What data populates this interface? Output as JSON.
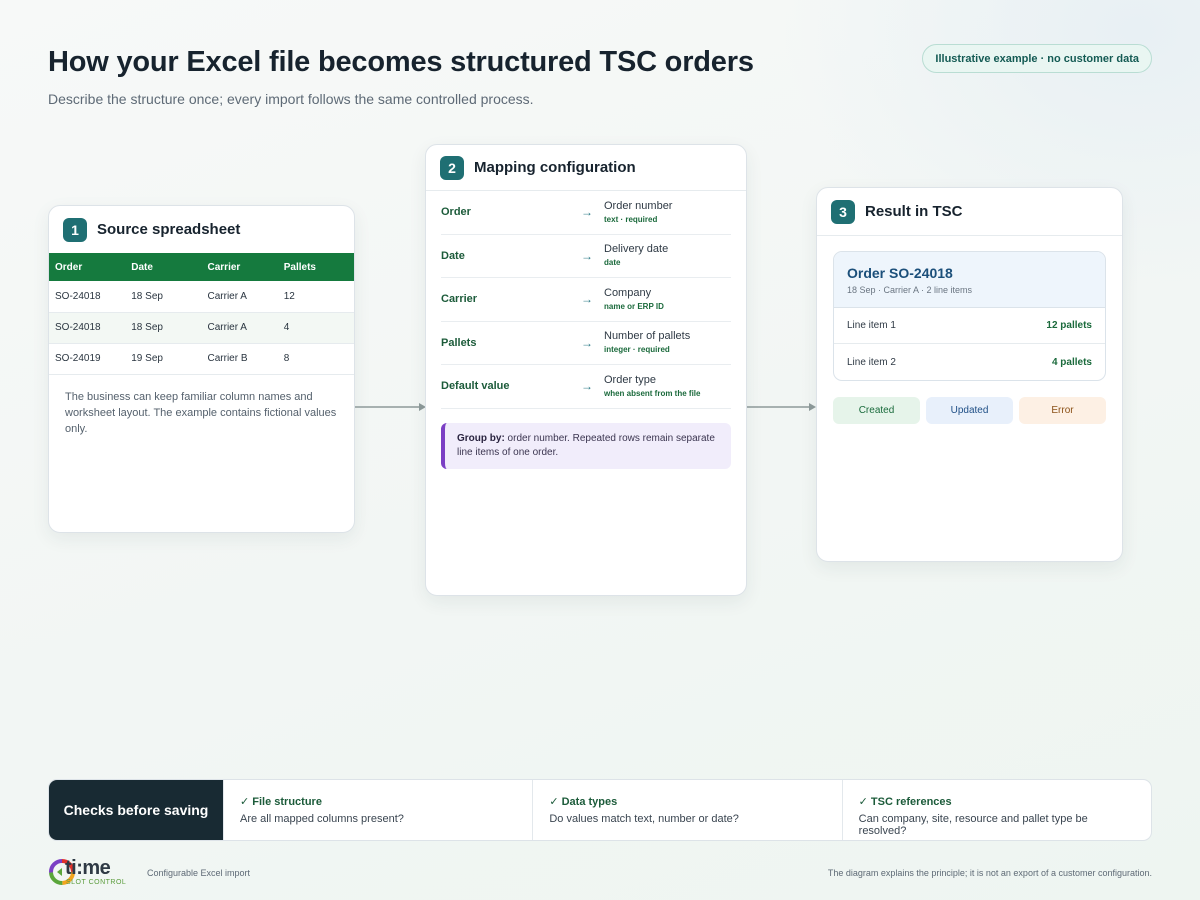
{
  "header": {
    "title": "How your Excel file becomes structured TSC orders",
    "subtitle": "Describe the structure once; every import follows the same controlled process.",
    "badge": "Illustrative example · no customer data"
  },
  "source": {
    "step": "1",
    "title": "Source spreadsheet",
    "columns": [
      "Order",
      "Date",
      "Carrier",
      "Pallets"
    ],
    "rows": [
      [
        "SO-24018",
        "18 Sep",
        "Carrier A",
        "12"
      ],
      [
        "SO-24018",
        "18 Sep",
        "Carrier A",
        "4"
      ],
      [
        "SO-24019",
        "19 Sep",
        "Carrier B",
        "8"
      ]
    ],
    "note": "The business can keep familiar column names and worksheet layout. The example contains fictional values only."
  },
  "mapping": {
    "step": "2",
    "title": "Mapping configuration",
    "arrow": "→",
    "rows": [
      {
        "source": "Order",
        "target": "Order number",
        "type": "text · required"
      },
      {
        "source": "Date",
        "target": "Delivery date",
        "type": "date"
      },
      {
        "source": "Carrier",
        "target": "Company",
        "type": "name or ERP ID"
      },
      {
        "source": "Pallets",
        "target": "Number of pallets",
        "type": "integer · required"
      },
      {
        "source": "Default value",
        "target": "Order type",
        "type": "when absent from the file"
      }
    ],
    "group_label": "Group by:",
    "group_text": " order number. Repeated rows remain separate line items of one order."
  },
  "result": {
    "step": "3",
    "title": "Result in TSC",
    "order_title": "Order SO-24018",
    "order_meta": "18 Sep · Carrier A · 2 line items",
    "lines": [
      {
        "label": "Line item 1",
        "qty": "12 pallets"
      },
      {
        "label": "Line item 2",
        "qty": "4 pallets"
      }
    ],
    "statuses": [
      "Created",
      "Updated",
      "Error"
    ]
  },
  "checks": {
    "title": "Checks before saving",
    "items": [
      {
        "title": "✓ File structure",
        "desc": "Are all mapped columns present?"
      },
      {
        "title": "✓ Data types",
        "desc": "Do values match text, number or date?"
      },
      {
        "title": "✓ TSC references",
        "desc": "Can company, site, resource and pallet type be resolved?"
      }
    ]
  },
  "footer": {
    "logo_text": "ti:me",
    "logo_sub": "SLOT CONTROL",
    "label": "Configurable Excel import",
    "note": "The diagram explains the principle; it is not an export of a customer configuration."
  },
  "colors": {
    "accent": "#1f6f73",
    "excel_green": "#157a3e",
    "group_purple": "#7b3fc4"
  }
}
